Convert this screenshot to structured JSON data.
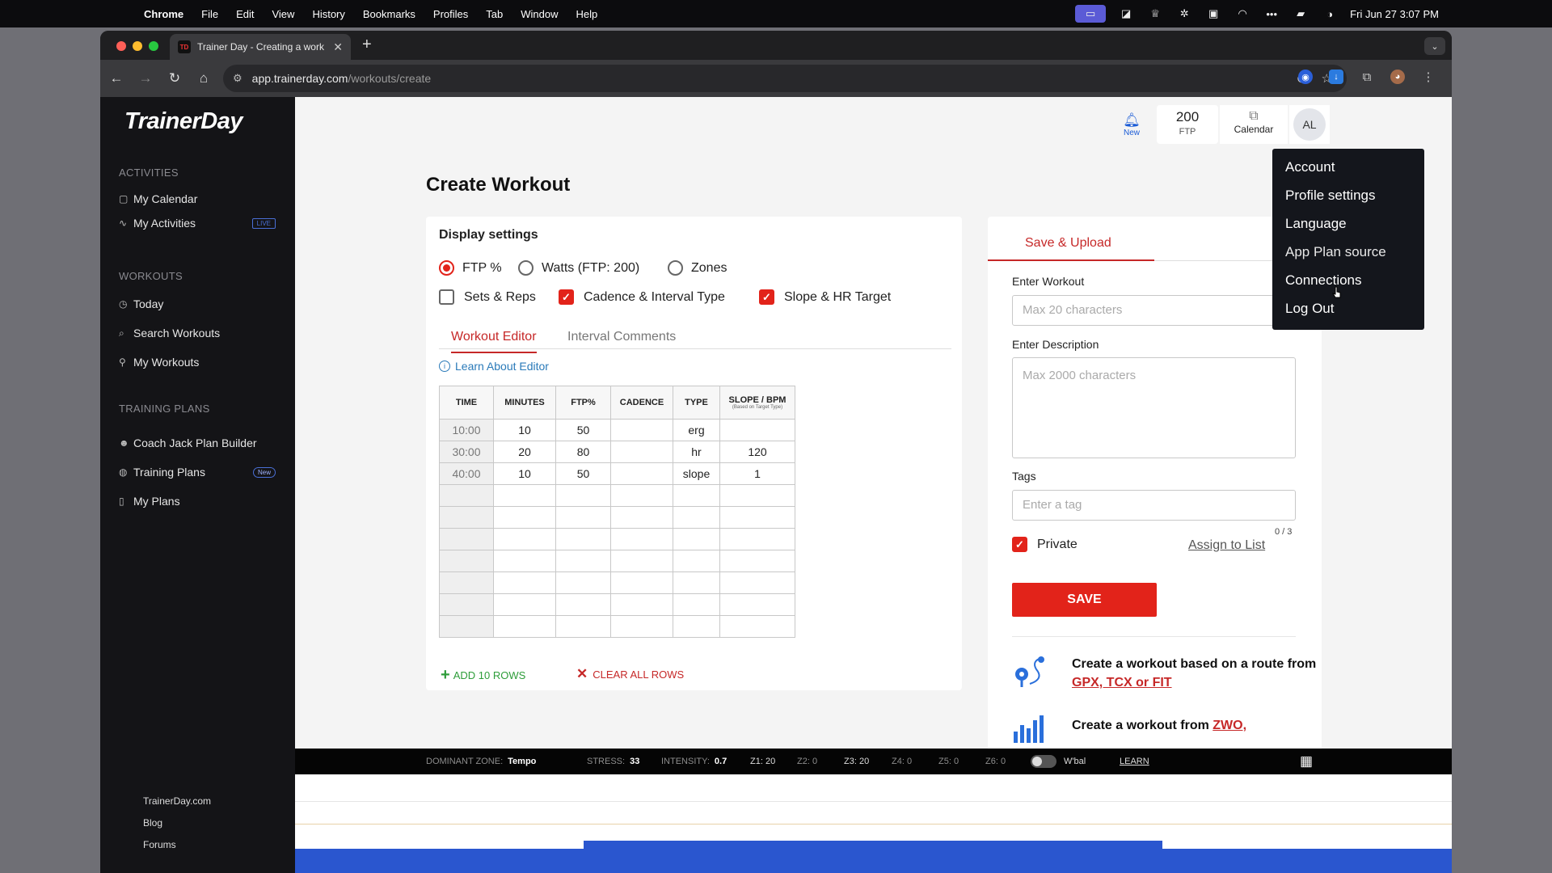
{
  "menubar": {
    "app": "Chrome",
    "items": [
      "File",
      "Edit",
      "View",
      "History",
      "Bookmarks",
      "Profiles",
      "Tab",
      "Window",
      "Help"
    ],
    "datetime": "Fri Jun 27  3:07 PM"
  },
  "browser": {
    "tab_title": "Trainer Day - Creating a work",
    "favicon": "TD",
    "url_host": "app.trainerday.com",
    "url_path": "/workouts/create"
  },
  "sidebar": {
    "logo": "TrainerDay",
    "sections": [
      {
        "heading": "ACTIVITIES",
        "items": [
          {
            "label": "My Calendar",
            "icon": "calendar-icon"
          },
          {
            "label": "My Activities",
            "icon": "activity-icon",
            "badge": "LIVE"
          }
        ]
      },
      {
        "heading": "WORKOUTS",
        "items": [
          {
            "label": "Today",
            "icon": "clock-icon"
          },
          {
            "label": "Search Workouts",
            "icon": "search-icon"
          },
          {
            "label": "My Workouts",
            "icon": "bike-icon"
          }
        ]
      },
      {
        "heading": "TRAINING PLANS",
        "items": [
          {
            "label": "Coach Jack Plan Builder",
            "icon": "coach-jack-icon"
          },
          {
            "label": "Training Plans",
            "icon": "plans-icon",
            "badge": "New"
          },
          {
            "label": "My Plans",
            "icon": "book-icon"
          }
        ]
      }
    ],
    "footer": [
      "TrainerDay.com",
      "Blog",
      "Forums"
    ]
  },
  "header": {
    "bell_label": "New",
    "ftp_value": "200",
    "ftp_label": "FTP",
    "calendar_label": "Calendar",
    "avatar": "AL"
  },
  "page": {
    "title": "Create Workout"
  },
  "display_settings": {
    "heading": "Display settings",
    "radios": [
      {
        "label": "FTP %",
        "selected": true
      },
      {
        "label": "Watts (FTP: 200)",
        "selected": false
      },
      {
        "label": "Zones",
        "selected": false
      }
    ],
    "checks": [
      {
        "label": "Sets & Reps",
        "checked": false
      },
      {
        "label": "Cadence & Interval Type",
        "checked": true
      },
      {
        "label": "Slope & HR Target",
        "checked": true
      }
    ]
  },
  "editor": {
    "tabs": [
      "Workout Editor",
      "Interval Comments"
    ],
    "learn": "Learn About Editor",
    "columns": [
      "TIME",
      "MINUTES",
      "FTP%",
      "CADENCE",
      "TYPE",
      "SLOPE / BPM"
    ],
    "slope_note": "(Based on Target Type)",
    "rows": [
      [
        "10:00",
        "10",
        "50",
        "",
        "erg",
        ""
      ],
      [
        "30:00",
        "20",
        "80",
        "",
        "hr",
        "120"
      ],
      [
        "40:00",
        "10",
        "50",
        "",
        "slope",
        "1"
      ],
      [
        "",
        "",
        "",
        "",
        "",
        ""
      ],
      [
        "",
        "",
        "",
        "",
        "",
        ""
      ],
      [
        "",
        "",
        "",
        "",
        "",
        ""
      ],
      [
        "",
        "",
        "",
        "",
        "",
        ""
      ],
      [
        "",
        "",
        "",
        "",
        "",
        ""
      ],
      [
        "",
        "",
        "",
        "",
        "",
        ""
      ],
      [
        "",
        "",
        "",
        "",
        "",
        ""
      ]
    ],
    "add_rows": "ADD 10 ROWS",
    "clear_rows": "CLEAR ALL ROWS"
  },
  "save_panel": {
    "tab": "Save & Upload",
    "workout_label": "Enter Workout",
    "workout_placeholder": "Max 20 characters",
    "desc_label": "Enter Description",
    "desc_placeholder": "Max 2000 characters",
    "tags_label": "Tags",
    "tags_placeholder": "Enter a tag",
    "tag_count": "0 / 3",
    "private_label": "Private",
    "assign": "Assign to List",
    "save": "SAVE",
    "promo1_text": "Create a workout based on a route from ",
    "promo1_link": "GPX, TCX or FIT",
    "promo2_text": "Create a workout from ",
    "promo2_link": "ZWO,"
  },
  "dropdown": {
    "items": [
      "Account",
      "Profile settings",
      "Language",
      "App Plan source",
      "Connections",
      "Log Out"
    ]
  },
  "status": {
    "dominant_label": "DOMINANT ZONE:",
    "dominant": "Tempo",
    "stress_label": "STRESS:",
    "stress": "33",
    "intensity_label": "INTENSITY:",
    "intensity": "0.7",
    "zones": [
      "Z1: 20",
      "Z2: 0",
      "Z3: 20",
      "Z4: 0",
      "Z5: 0",
      "Z6: 0"
    ],
    "wbal": "W'bal",
    "learn": "LEARN"
  }
}
